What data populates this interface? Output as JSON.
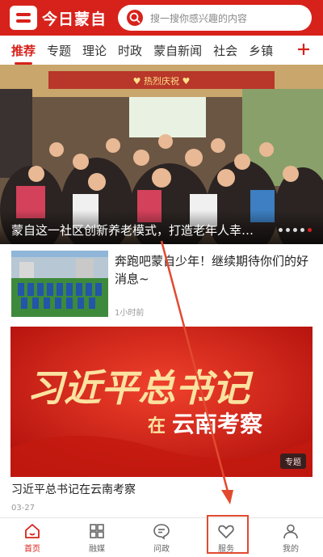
{
  "header": {
    "app_name": "今日蒙自",
    "search_placeholder": "搜一搜你感兴趣的内容"
  },
  "tabs": [
    {
      "label": "推荐",
      "active": true
    },
    {
      "label": "专题"
    },
    {
      "label": "理论"
    },
    {
      "label": "时政"
    },
    {
      "label": "蒙自新闻"
    },
    {
      "label": "社会"
    },
    {
      "label": "乡镇"
    }
  ],
  "hero": {
    "caption": "蒙自这一社区创新养老模式，打造老年人幸福…",
    "banner_text": "♥ 热烈庆祝 ♥",
    "dots": 5,
    "active_dot": 4
  },
  "news": [
    {
      "title": "奔跑吧蒙自少年！继续期待你们的好消息~",
      "time": "1小时前"
    }
  ],
  "feature": {
    "poster_line1": "习近平总书记",
    "poster_line2_a": "在",
    "poster_line2_b": "云南考察",
    "tag": "专题",
    "title": "习近平总书记在云南考察",
    "date": "03-27"
  },
  "bottom_nav": [
    {
      "label": "首页",
      "icon": "home-icon",
      "active": true
    },
    {
      "label": "融媒",
      "icon": "grid-icon"
    },
    {
      "label": "问政",
      "icon": "chat-icon"
    },
    {
      "label": "服务",
      "icon": "heart-icon"
    },
    {
      "label": "我的",
      "icon": "person-icon"
    }
  ],
  "colors": {
    "brand": "#d7221b",
    "annotation": "#e24a30"
  }
}
